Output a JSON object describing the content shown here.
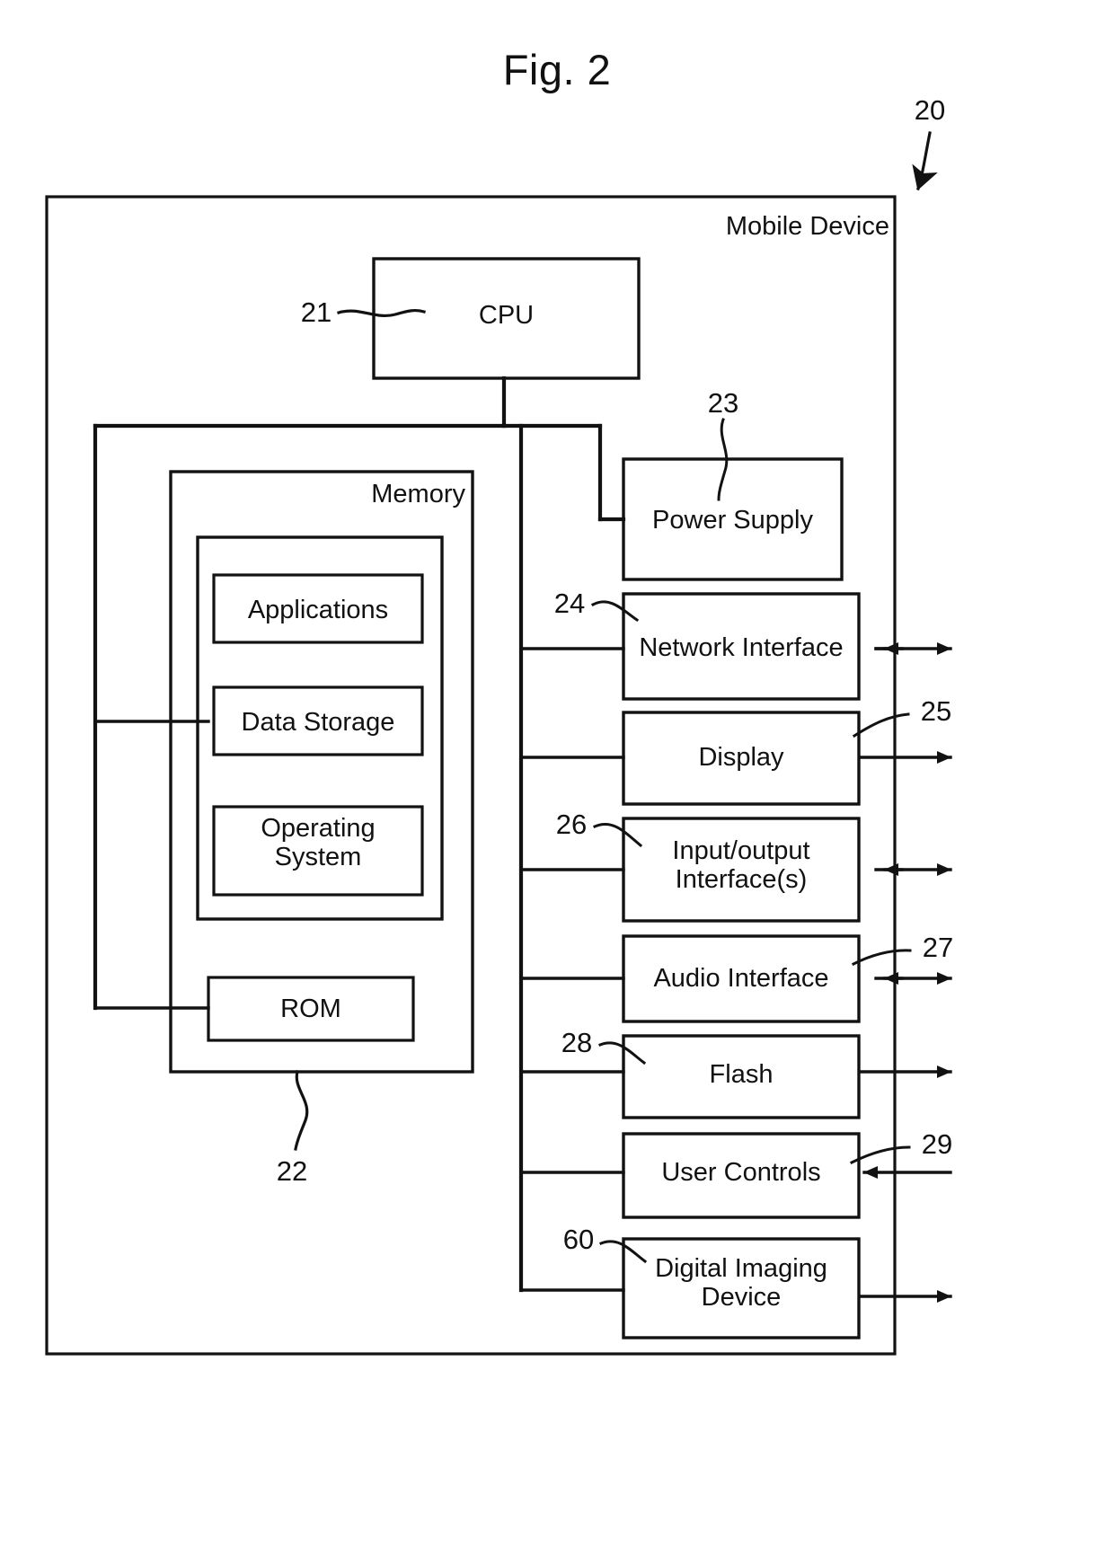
{
  "figure": {
    "title": "Fig. 2",
    "root_numeral": "20",
    "outer_box_label": "Mobile Device"
  },
  "cpu": {
    "label": "CPU",
    "numeral": "21"
  },
  "memory": {
    "label": "Memory",
    "numeral": "22",
    "items": [
      {
        "label": "Applications"
      },
      {
        "label": "Data Storage"
      },
      {
        "label": "Operating\nSystem"
      }
    ],
    "rom": {
      "label": "ROM"
    }
  },
  "peripherals": [
    {
      "label": "Power Supply",
      "numeral": "23",
      "arrow": "none"
    },
    {
      "label": "Network Interface",
      "numeral": "24",
      "arrow": "both"
    },
    {
      "label": "Display",
      "numeral": "25",
      "arrow": "out"
    },
    {
      "label": "Input/output\nInterface(s)",
      "numeral": "26",
      "arrow": "both"
    },
    {
      "label": "Audio Interface",
      "numeral": "27",
      "arrow": "both"
    },
    {
      "label": "Flash",
      "numeral": "28",
      "arrow": "out"
    },
    {
      "label": "User Controls",
      "numeral": "29",
      "arrow": "in"
    },
    {
      "label": "Digital Imaging\nDevice",
      "numeral": "60",
      "arrow": "out"
    }
  ],
  "style": {
    "ink": "#121212",
    "paper": "#ffffff"
  }
}
